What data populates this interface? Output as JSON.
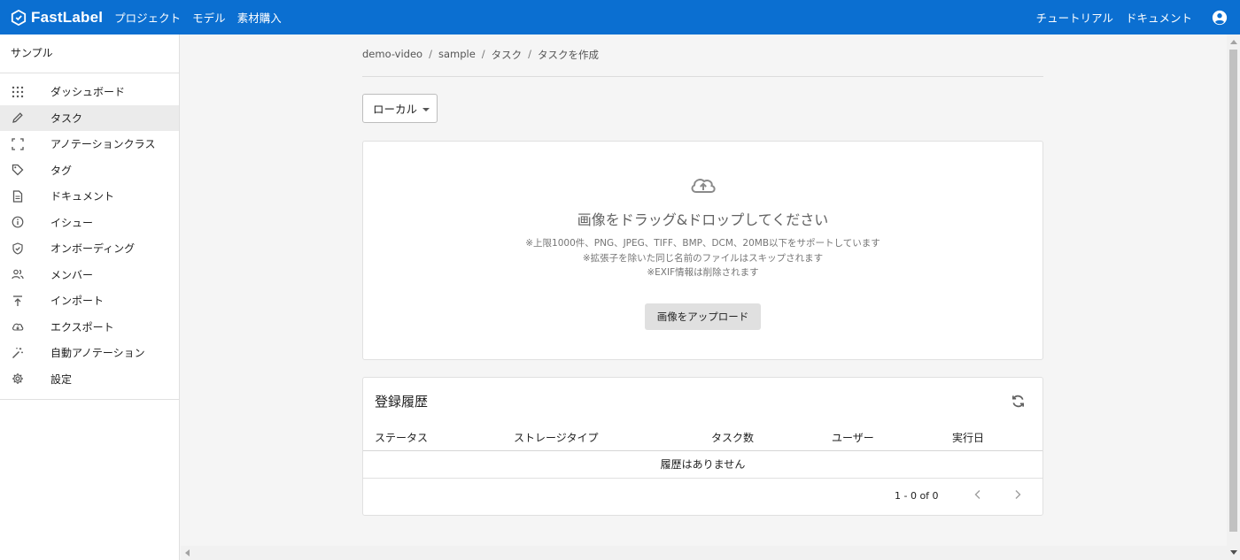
{
  "brand": {
    "name": "FastLabel",
    "color": "#0b6fd1"
  },
  "topnav": {
    "left": [
      "プロジェクト",
      "モデル",
      "素材購入"
    ],
    "right": [
      "チュートリアル",
      "ドキュメント"
    ]
  },
  "sidebar": {
    "project": "サンプル",
    "items": [
      {
        "label": "ダッシュボード",
        "icon": "grid-icon"
      },
      {
        "label": "タスク",
        "icon": "pencil-icon",
        "active": true
      },
      {
        "label": "アノテーションクラス",
        "icon": "bounding-box-icon"
      },
      {
        "label": "タグ",
        "icon": "tag-icon"
      },
      {
        "label": "ドキュメント",
        "icon": "document-icon"
      },
      {
        "label": "イシュー",
        "icon": "info-icon"
      },
      {
        "label": "オンボーディング",
        "icon": "shield-check-icon"
      },
      {
        "label": "メンバー",
        "icon": "people-icon"
      },
      {
        "label": "インポート",
        "icon": "import-icon"
      },
      {
        "label": "エクスポート",
        "icon": "cloud-download-icon"
      },
      {
        "label": "自動アノテーション",
        "icon": "magic-wand-icon"
      },
      {
        "label": "設定",
        "icon": "gear-icon"
      }
    ]
  },
  "breadcrumb": [
    "demo-video",
    "sample",
    "タスク",
    "タスクを作成"
  ],
  "source_select": {
    "value": "ローカル"
  },
  "upload": {
    "title": "画像をドラッグ&ドロップしてください",
    "notes": [
      "※上限1000件、PNG、JPEG、TIFF、BMP、DCM、20MB以下をサポートしています",
      "※拡張子を除いた同じ名前のファイルはスキップされます",
      "※EXIF情報は削除されます"
    ],
    "button": "画像をアップロード"
  },
  "history": {
    "title": "登録履歴",
    "columns": [
      "ステータス",
      "ストレージタイプ",
      "タスク数",
      "ユーザー",
      "実行日"
    ],
    "empty": "履歴はありません",
    "pagination": "1 - 0 of 0"
  }
}
